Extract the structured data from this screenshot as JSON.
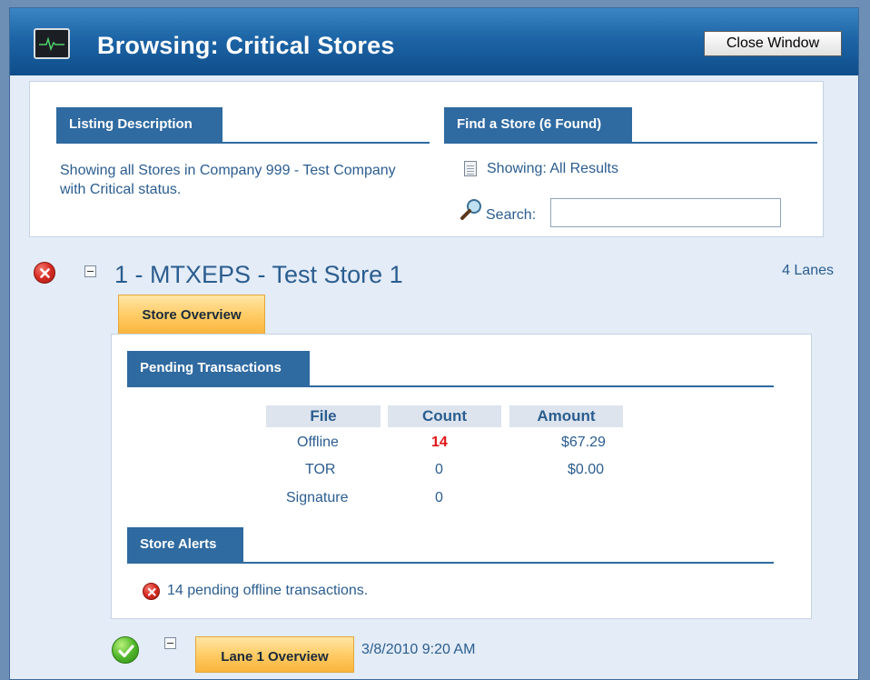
{
  "window": {
    "title": "Browsing: Critical Stores",
    "close_label": "Close Window",
    "app_icon": "monitor-pulse-icon"
  },
  "listing": {
    "header": "Listing Description",
    "text": "Showing all Stores in Company 999 - Test Company with Critical status."
  },
  "find": {
    "header": "Find a Store (6 Found)",
    "showing": "Showing: All Results",
    "search_label": "Search:",
    "search_value": ""
  },
  "store": {
    "status_icon": "error-icon",
    "title": "1 - MTXEPS - Test Store 1",
    "lanes": "4 Lanes",
    "tab_label": "Store Overview",
    "pending": {
      "header": "Pending Transactions",
      "columns": [
        "File",
        "Count",
        "Amount"
      ],
      "rows": [
        {
          "file": "Offline",
          "count": "14",
          "amount": "$67.29"
        },
        {
          "file": "TOR",
          "count": "0",
          "amount": "$0.00"
        },
        {
          "file": "Signature",
          "count": "0",
          "amount": ""
        }
      ]
    },
    "alerts": {
      "header": "Store Alerts",
      "items": [
        "14 pending offline transactions."
      ]
    }
  },
  "lane": {
    "status_icon": "success-icon",
    "tab_label": "Lane 1 Overview",
    "date": "3/8/2010 9:20 AM"
  },
  "colors": {
    "title_blue": "#1d65a6",
    "section_blue": "#2f6aa0",
    "text_blue": "#2b5d8f",
    "alert_red": "#e01414",
    "tab_orange": "#ffcc66"
  }
}
